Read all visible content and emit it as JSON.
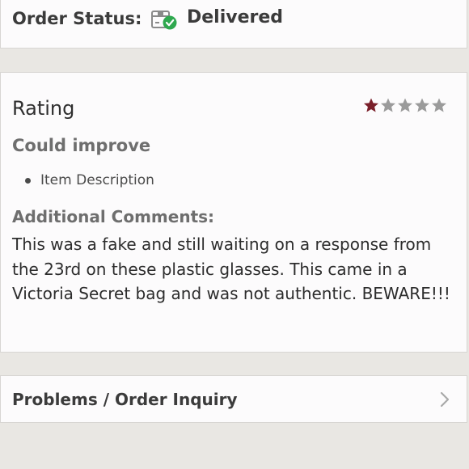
{
  "order_status": {
    "label": "Order Status:",
    "value": "Delivered",
    "icon": "package-delivered-icon",
    "check_color": "#2fa84f"
  },
  "rating": {
    "title": "Rating",
    "stars_filled": 1,
    "stars_total": 5,
    "filled_color": "#7a1f2a",
    "empty_color": "#9b9b9b"
  },
  "could_improve": {
    "title": "Could improve",
    "items": [
      "Item Description"
    ]
  },
  "additional_comments": {
    "title": "Additional Comments:",
    "text": "This was a fake and still waiting on a response from the 23rd on these plastic glasses. This came in a Victoria Secret bag and was not authentic. BEWARE!!!"
  },
  "problems": {
    "label": "Problems / Order Inquiry",
    "icon": "chevron-right-icon"
  }
}
